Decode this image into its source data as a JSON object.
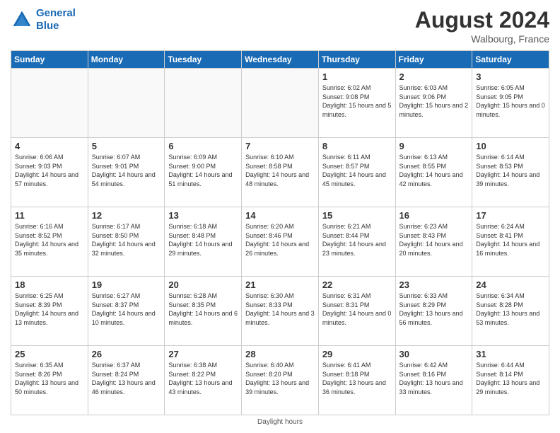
{
  "header": {
    "logo_line1": "General",
    "logo_line2": "Blue",
    "month": "August 2024",
    "location": "Walbourg, France"
  },
  "footer": {
    "note": "Daylight hours"
  },
  "weekdays": [
    "Sunday",
    "Monday",
    "Tuesday",
    "Wednesday",
    "Thursday",
    "Friday",
    "Saturday"
  ],
  "weeks": [
    [
      {
        "day": "",
        "sunrise": "",
        "sunset": "",
        "daylight": ""
      },
      {
        "day": "",
        "sunrise": "",
        "sunset": "",
        "daylight": ""
      },
      {
        "day": "",
        "sunrise": "",
        "sunset": "",
        "daylight": ""
      },
      {
        "day": "",
        "sunrise": "",
        "sunset": "",
        "daylight": ""
      },
      {
        "day": "1",
        "sunrise": "6:02 AM",
        "sunset": "9:08 PM",
        "daylight": "15 hours and 5 minutes."
      },
      {
        "day": "2",
        "sunrise": "6:03 AM",
        "sunset": "9:06 PM",
        "daylight": "15 hours and 2 minutes."
      },
      {
        "day": "3",
        "sunrise": "6:05 AM",
        "sunset": "9:05 PM",
        "daylight": "15 hours and 0 minutes."
      }
    ],
    [
      {
        "day": "4",
        "sunrise": "6:06 AM",
        "sunset": "9:03 PM",
        "daylight": "14 hours and 57 minutes."
      },
      {
        "day": "5",
        "sunrise": "6:07 AM",
        "sunset": "9:01 PM",
        "daylight": "14 hours and 54 minutes."
      },
      {
        "day": "6",
        "sunrise": "6:09 AM",
        "sunset": "9:00 PM",
        "daylight": "14 hours and 51 minutes."
      },
      {
        "day": "7",
        "sunrise": "6:10 AM",
        "sunset": "8:58 PM",
        "daylight": "14 hours and 48 minutes."
      },
      {
        "day": "8",
        "sunrise": "6:11 AM",
        "sunset": "8:57 PM",
        "daylight": "14 hours and 45 minutes."
      },
      {
        "day": "9",
        "sunrise": "6:13 AM",
        "sunset": "8:55 PM",
        "daylight": "14 hours and 42 minutes."
      },
      {
        "day": "10",
        "sunrise": "6:14 AM",
        "sunset": "8:53 PM",
        "daylight": "14 hours and 39 minutes."
      }
    ],
    [
      {
        "day": "11",
        "sunrise": "6:16 AM",
        "sunset": "8:52 PM",
        "daylight": "14 hours and 35 minutes."
      },
      {
        "day": "12",
        "sunrise": "6:17 AM",
        "sunset": "8:50 PM",
        "daylight": "14 hours and 32 minutes."
      },
      {
        "day": "13",
        "sunrise": "6:18 AM",
        "sunset": "8:48 PM",
        "daylight": "14 hours and 29 minutes."
      },
      {
        "day": "14",
        "sunrise": "6:20 AM",
        "sunset": "8:46 PM",
        "daylight": "14 hours and 26 minutes."
      },
      {
        "day": "15",
        "sunrise": "6:21 AM",
        "sunset": "8:44 PM",
        "daylight": "14 hours and 23 minutes."
      },
      {
        "day": "16",
        "sunrise": "6:23 AM",
        "sunset": "8:43 PM",
        "daylight": "14 hours and 20 minutes."
      },
      {
        "day": "17",
        "sunrise": "6:24 AM",
        "sunset": "8:41 PM",
        "daylight": "14 hours and 16 minutes."
      }
    ],
    [
      {
        "day": "18",
        "sunrise": "6:25 AM",
        "sunset": "8:39 PM",
        "daylight": "14 hours and 13 minutes."
      },
      {
        "day": "19",
        "sunrise": "6:27 AM",
        "sunset": "8:37 PM",
        "daylight": "14 hours and 10 minutes."
      },
      {
        "day": "20",
        "sunrise": "6:28 AM",
        "sunset": "8:35 PM",
        "daylight": "14 hours and 6 minutes."
      },
      {
        "day": "21",
        "sunrise": "6:30 AM",
        "sunset": "8:33 PM",
        "daylight": "14 hours and 3 minutes."
      },
      {
        "day": "22",
        "sunrise": "6:31 AM",
        "sunset": "8:31 PM",
        "daylight": "14 hours and 0 minutes."
      },
      {
        "day": "23",
        "sunrise": "6:33 AM",
        "sunset": "8:29 PM",
        "daylight": "13 hours and 56 minutes."
      },
      {
        "day": "24",
        "sunrise": "6:34 AM",
        "sunset": "8:28 PM",
        "daylight": "13 hours and 53 minutes."
      }
    ],
    [
      {
        "day": "25",
        "sunrise": "6:35 AM",
        "sunset": "8:26 PM",
        "daylight": "13 hours and 50 minutes."
      },
      {
        "day": "26",
        "sunrise": "6:37 AM",
        "sunset": "8:24 PM",
        "daylight": "13 hours and 46 minutes."
      },
      {
        "day": "27",
        "sunrise": "6:38 AM",
        "sunset": "8:22 PM",
        "daylight": "13 hours and 43 minutes."
      },
      {
        "day": "28",
        "sunrise": "6:40 AM",
        "sunset": "8:20 PM",
        "daylight": "13 hours and 39 minutes."
      },
      {
        "day": "29",
        "sunrise": "6:41 AM",
        "sunset": "8:18 PM",
        "daylight": "13 hours and 36 minutes."
      },
      {
        "day": "30",
        "sunrise": "6:42 AM",
        "sunset": "8:16 PM",
        "daylight": "13 hours and 33 minutes."
      },
      {
        "day": "31",
        "sunrise": "6:44 AM",
        "sunset": "8:14 PM",
        "daylight": "13 hours and 29 minutes."
      }
    ]
  ]
}
